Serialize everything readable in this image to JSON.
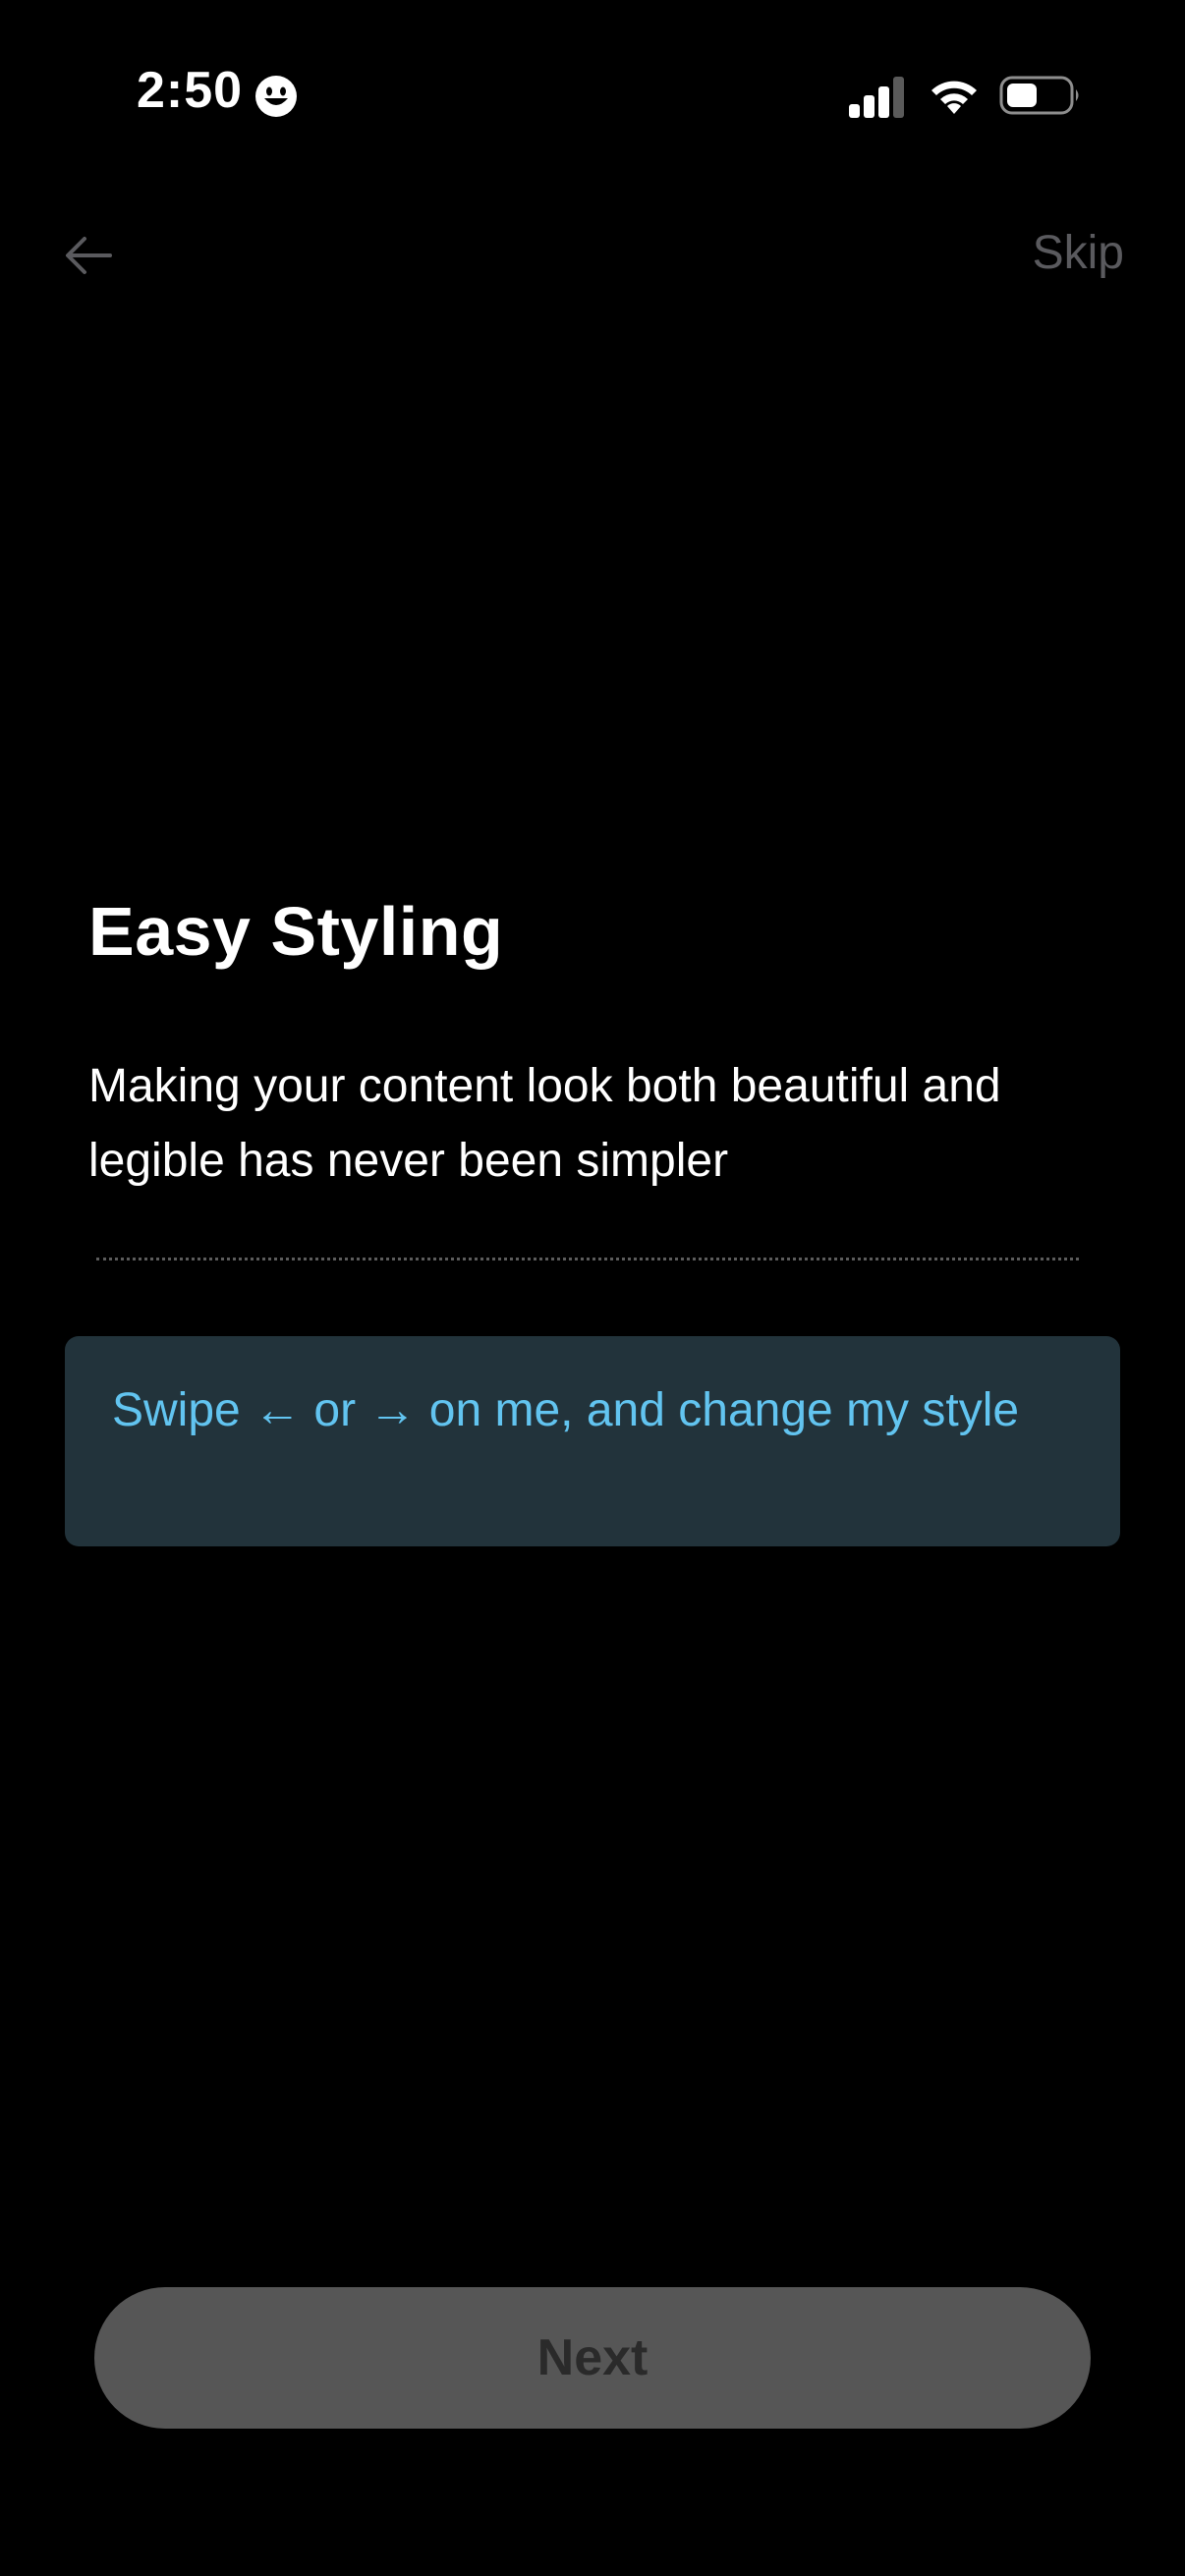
{
  "status_bar": {
    "time": "2:50",
    "emoji_icon": "smiley-face-icon",
    "signal_icon": "cellular-signal-icon",
    "wifi_icon": "wifi-icon",
    "battery_icon": "battery-icon"
  },
  "nav": {
    "back_icon": "arrow-left-icon",
    "skip_label": "Skip"
  },
  "content": {
    "title": "Easy Styling",
    "description": "Making your content look both beautiful and legible has never been simpler",
    "swipe_card_text": "Swipe ← or → on me, and change my style"
  },
  "footer": {
    "next_label": "Next"
  },
  "colors": {
    "background": "#000000",
    "title_text": "#ffffff",
    "skip_text": "#5a5a5e",
    "card_background": "#22333b",
    "card_text": "#62c4f0",
    "next_button_background": "#565656",
    "next_button_text": "#2a2a2a"
  }
}
